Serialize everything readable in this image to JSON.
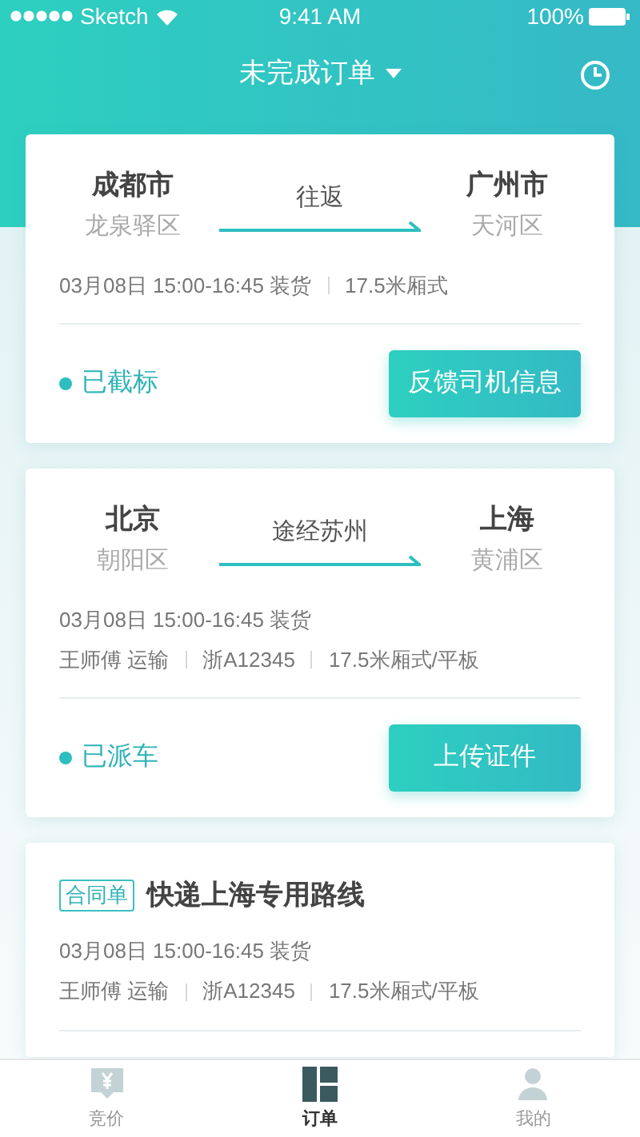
{
  "status_bar": {
    "carrier": "Sketch",
    "time": "9:41 AM",
    "battery": "100%"
  },
  "header": {
    "title": "未完成订单"
  },
  "orders": [
    {
      "kind": "route",
      "from": {
        "city": "成都市",
        "district": "龙泉驿区"
      },
      "via": "往返",
      "to": {
        "city": "广州市",
        "district": "天河区"
      },
      "info_lines": [
        [
          "03月08日 15:00-16:45 装货",
          "17.5米厢式"
        ]
      ],
      "status": "已截标",
      "action": "反馈司机信息"
    },
    {
      "kind": "route",
      "from": {
        "city": "北京",
        "district": "朝阳区"
      },
      "via": "途经苏州",
      "to": {
        "city": "上海",
        "district": "黄浦区"
      },
      "info_lines": [
        [
          "03月08日 15:00-16:45 装货"
        ],
        [
          "王师傅 运输",
          "浙A12345",
          "17.5米厢式/平板"
        ]
      ],
      "status": "已派车",
      "action": "上传证件"
    },
    {
      "kind": "contract",
      "tag": "合同单",
      "title": "快递上海专用路线",
      "info_lines": [
        [
          "03月08日 15:00-16:45 装货"
        ],
        [
          "王师傅 运输",
          "浙A12345",
          "17.5米厢式/平板"
        ]
      ]
    }
  ],
  "tab_bar": [
    {
      "label": "竞价",
      "selected": false
    },
    {
      "label": "订单",
      "selected": true
    },
    {
      "label": "我的",
      "selected": false
    }
  ]
}
